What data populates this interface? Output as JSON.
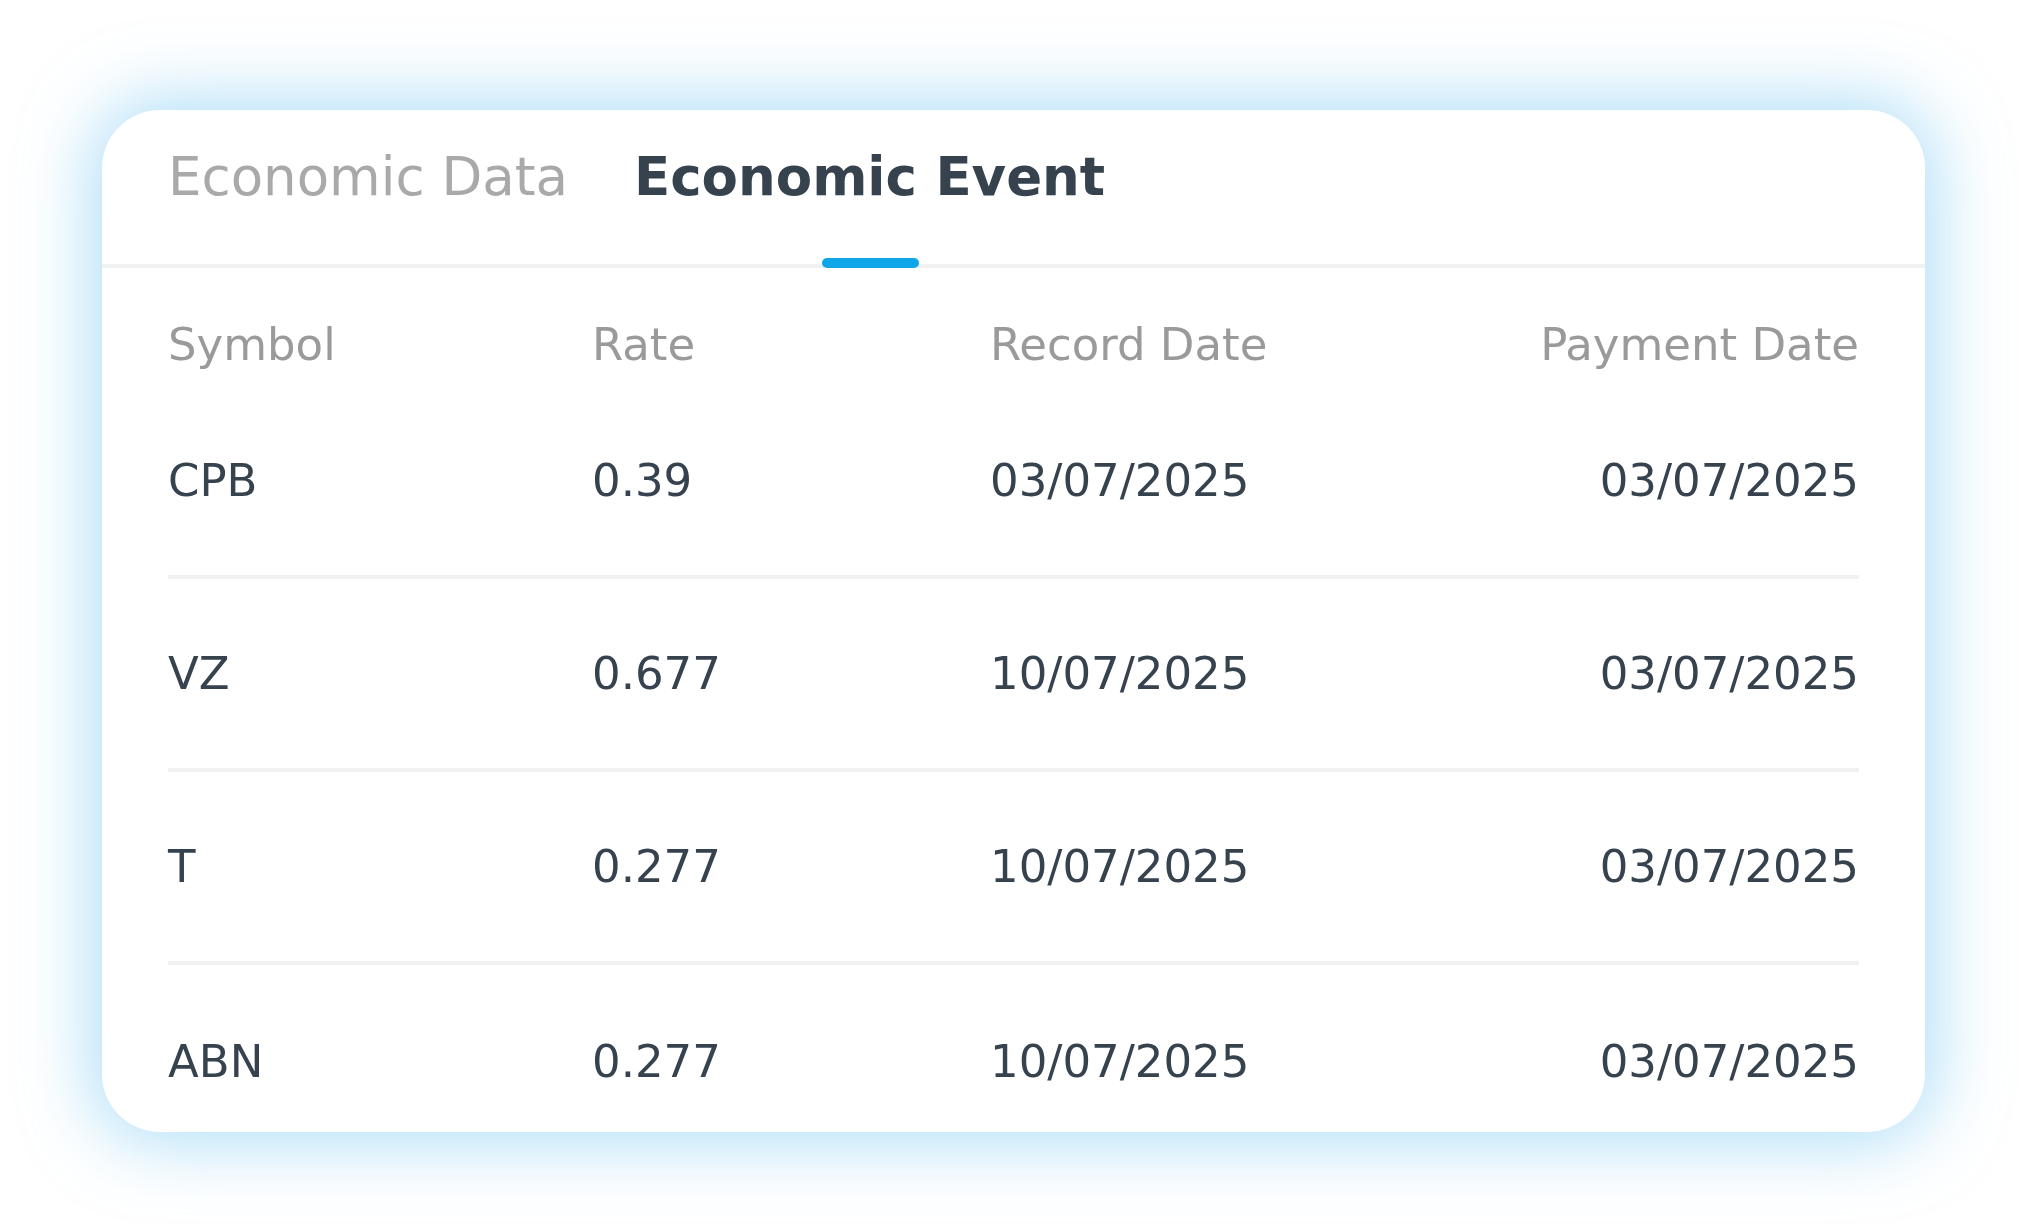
{
  "tabs": [
    {
      "label": "Economic Data",
      "selected": false
    },
    {
      "label": "Economic Event",
      "selected": true
    }
  ],
  "table": {
    "columns": [
      "Symbol",
      "Rate",
      "Record Date",
      "Payment Date"
    ],
    "rows": [
      [
        "CPB",
        "0.39",
        "03/07/2025",
        "03/07/2025"
      ],
      [
        "VZ",
        "0.677",
        "10/07/2025",
        "03/07/2025"
      ],
      [
        "T",
        "0.277",
        "10/07/2025",
        "03/07/2025"
      ],
      [
        "ABN",
        "0.277",
        "10/07/2025",
        "03/07/2025"
      ]
    ]
  }
}
